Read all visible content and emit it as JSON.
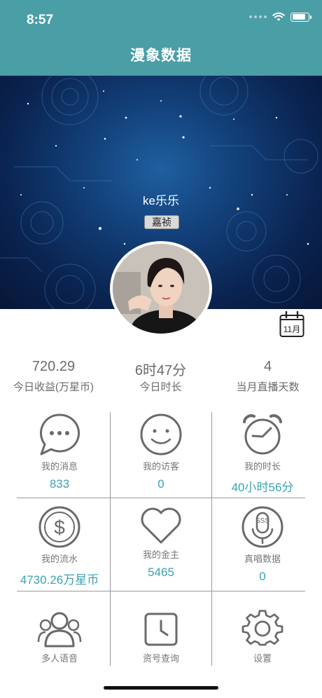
{
  "status": {
    "time": "8:57",
    "battery_level": 0.85
  },
  "nav": {
    "title": "漫象数据"
  },
  "profile": {
    "username": "ke乐乐",
    "badge": "嘉祯",
    "calendar_label": "11月"
  },
  "stats": [
    {
      "value": "720.29",
      "label": "今日收益(万星币)"
    },
    {
      "value": "6时47分",
      "label": "今日时长"
    },
    {
      "value": "4",
      "label": "当月直播天数"
    }
  ],
  "grid": [
    {
      "icon": "chat-bubble-icon",
      "label": "我的消息",
      "value": "833"
    },
    {
      "icon": "smiley-face-icon",
      "label": "我的访客",
      "value": "0"
    },
    {
      "icon": "alarm-clock-icon",
      "label": "我的时长",
      "value": "40小时56分"
    },
    {
      "icon": "dollar-coin-icon",
      "label": "我的流水",
      "value": "4730.26万星币"
    },
    {
      "icon": "heart-icon",
      "label": "我的金主",
      "value": "5465"
    },
    {
      "icon": "microphone-icon",
      "label": "真唱数据",
      "value": "0"
    },
    {
      "icon": "users-icon",
      "label": "多人语音",
      "value": ""
    },
    {
      "icon": "clock-icon",
      "label": "资号查询",
      "value": ""
    },
    {
      "icon": "gear-icon",
      "label": "设置",
      "value": ""
    }
  ],
  "colors": {
    "accent": "#4a9ea6",
    "value_text": "#3aa3b0",
    "muted_text": "#6b6b6b"
  }
}
